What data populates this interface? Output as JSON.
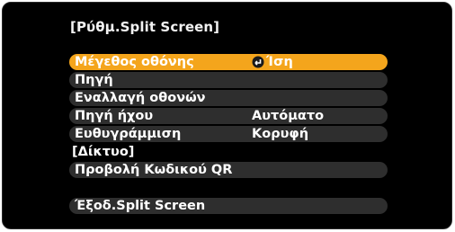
{
  "title": "[Ρύθμ.Split Screen]",
  "menu": {
    "size": {
      "label": "Μέγεθος οθόνης",
      "value": "Ίση",
      "icon": "enter-icon",
      "selected": true
    },
    "source": {
      "label": "Πηγή"
    },
    "swap": {
      "label": "Εναλλαγή οθονών"
    },
    "audio": {
      "label": "Πηγή ήχου",
      "value": "Αυτόματο"
    },
    "align": {
      "label": "Ευθυγράμμιση",
      "value": "Κορυφή"
    }
  },
  "network": {
    "heading": "[Δίκτυο]",
    "qr_label": "Προβολή Κωδικού QR"
  },
  "exit_label": "Έξοδ.Split Screen",
  "colors": {
    "background": "#000000",
    "selected_row": "#f4a51c",
    "row": "#2e2e2e",
    "text": "#ffffff"
  }
}
